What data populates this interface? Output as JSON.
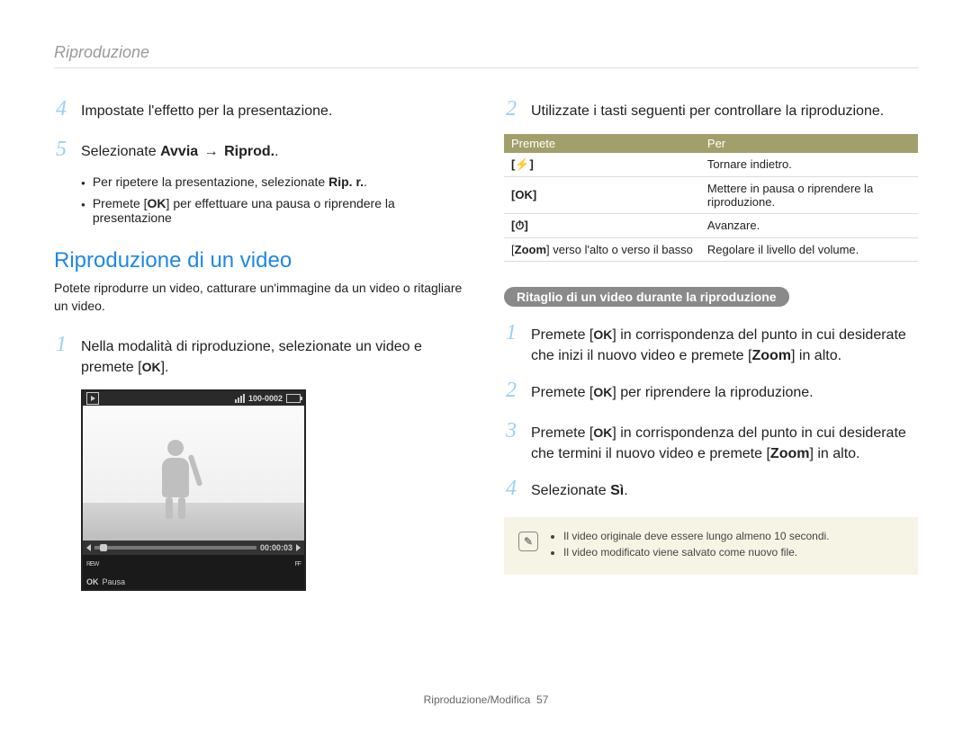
{
  "breadcrumb": "Riproduzione",
  "left": {
    "step4_num": "4",
    "step4_text": "Impostate l'effetto per la presentazione.",
    "step5_num": "5",
    "step5_pre": "Selezionate ",
    "step5_bold_a": "Avvia",
    "step5_arrow": "→",
    "step5_bold_b": "Riprod.",
    "step5_post": ".",
    "bullet1_pre": "Per ripetere la presentazione, selezionate ",
    "bullet1_bold": "Rip. r.",
    "bullet1_post": ".",
    "bullet2_pre": "Premete [",
    "bullet2_ok": "OK",
    "bullet2_post": "] per effettuare una pausa o riprendere la presentazione",
    "h2": "Riproduzione di un video",
    "lead": "Potete riprodurre un video, catturare un'immagine da un video o ritagliare un video.",
    "vstep1_num": "1",
    "vstep1_pre": "Nella modalità di riproduzione, selezionate un video e premete [",
    "vstep1_ok": "OK",
    "vstep1_post": "].",
    "video": {
      "counter": "100-0002",
      "time": "00:00:03",
      "rew": "REW",
      "ff": "FF",
      "ok": "OK",
      "pausa": "Pausa"
    }
  },
  "right": {
    "step2_num": "2",
    "step2_text": "Utilizzate i tasti seguenti per controllare la riproduzione.",
    "table": {
      "head_a": "Premete",
      "head_b": "Per",
      "rows": [
        {
          "key": "[⚡]",
          "val": "Tornare indietro."
        },
        {
          "key": "[OK]",
          "val": "Mettere in pausa o riprendere la riproduzione."
        },
        {
          "key": "[⏱]",
          "val": "Avanzare."
        },
        {
          "key_a": "[",
          "key_b": "Zoom",
          "key_c": "] verso l'alto o verso il basso",
          "val": "Regolare il livello del volume."
        }
      ]
    },
    "pill": "Ritaglio di un video durante la riproduzione",
    "t1_num": "1",
    "t1_pre": "Premete [",
    "t1_ok": "OK",
    "t1_mid": "] in corrispondenza del punto in cui desiderate che inizi il nuovo video e premete [",
    "t1_bold": "Zoom",
    "t1_post": "] in alto.",
    "t2_num": "2",
    "t2_pre": "Premete [",
    "t2_ok": "OK",
    "t2_post": "] per riprendere la riproduzione.",
    "t3_num": "3",
    "t3_pre": "Premete [",
    "t3_ok": "OK",
    "t3_mid": "] in corrispondenza del punto in cui desiderate che termini il nuovo video e premete [",
    "t3_bold": "Zoom",
    "t3_post": "] in alto.",
    "t4_num": "4",
    "t4_pre": "Selezionate ",
    "t4_bold": "Sì",
    "t4_post": ".",
    "note1": "Il video originale deve essere lungo almeno 10 secondi.",
    "note2": "Il video modificato viene salvato come nuovo file."
  },
  "footer_label": "Riproduzione/Modifica",
  "footer_page": "57"
}
